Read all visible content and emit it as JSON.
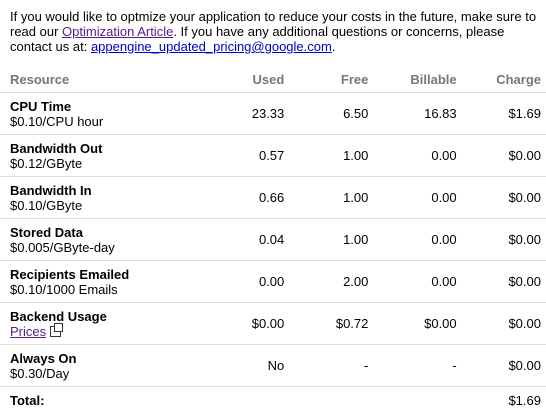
{
  "intro": {
    "text_before": "If you would like to optmize your application to reduce your costs in the future, make sure to read our ",
    "link_text": "Optimization Article",
    "text_middle": ". If you have any additional questions or concerns, please contact us at: ",
    "email": "appengine_updated_pricing@google.com",
    "text_after": "."
  },
  "table": {
    "headers": {
      "resource": "Resource",
      "used": "Used",
      "free": "Free",
      "billable": "Billable",
      "charge": "Charge"
    },
    "rows": [
      {
        "name": "CPU Time",
        "rate": "$0.10/CPU hour",
        "used": "23.33",
        "free": "6.50",
        "billable": "16.83",
        "charge": "$1.69"
      },
      {
        "name": "Bandwidth Out",
        "rate": "$0.12/GByte",
        "used": "0.57",
        "free": "1.00",
        "billable": "0.00",
        "charge": "$0.00"
      },
      {
        "name": "Bandwidth In",
        "rate": "$0.10/GByte",
        "used": "0.66",
        "free": "1.00",
        "billable": "0.00",
        "charge": "$0.00"
      },
      {
        "name": "Stored Data",
        "rate": "$0.005/GByte-day",
        "used": "0.04",
        "free": "1.00",
        "billable": "0.00",
        "charge": "$0.00"
      },
      {
        "name": "Recipients Emailed",
        "rate": "$0.10/1000 Emails",
        "used": "0.00",
        "free": "2.00",
        "billable": "0.00",
        "charge": "$0.00"
      },
      {
        "name": "Backend Usage",
        "rate_link": "Prices",
        "rate_icon": "external-link-icon",
        "used": "$0.00",
        "free": "$0.72",
        "billable": "$0.00",
        "charge": "$0.00"
      },
      {
        "name": "Always On",
        "rate": "$0.30/Day",
        "used": "No",
        "free": "-",
        "billable": "-",
        "charge": "$0.00"
      }
    ],
    "total": {
      "label": "Total:",
      "charge": "$1.69"
    }
  }
}
